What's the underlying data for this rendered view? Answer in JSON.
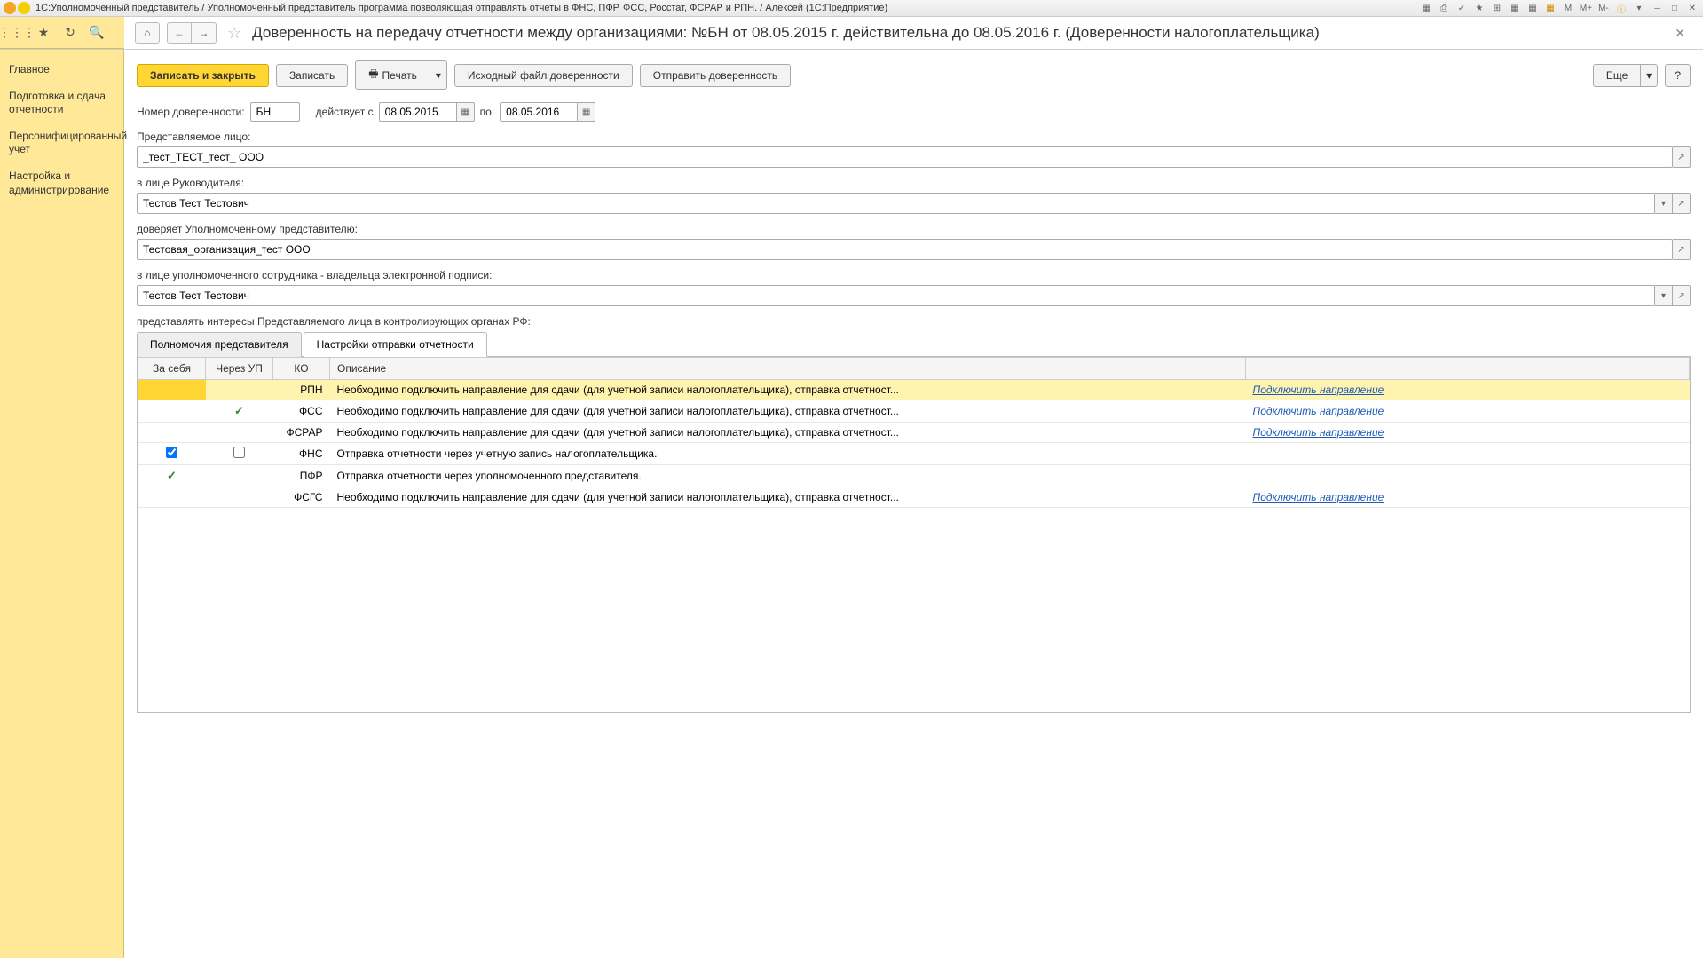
{
  "titlebar": {
    "text": "1С:Уполномоченный представитель / Уполномоченный представитель программа позволяющая отправлять отчеты в ФНС, ПФР, ФСС, Росстат, ФСРАР и РПН. / Алексей  (1С:Предприятие)",
    "winIcons": [
      "M",
      "M+",
      "M-"
    ]
  },
  "page": {
    "title": "Доверенность на передачу отчетности между организациями: №БН от 08.05.2015 г. действительна до 08.05.2016 г. (Доверенности налогоплательщика)"
  },
  "sidebar": {
    "items": [
      {
        "label": "Главное"
      },
      {
        "label": "Подготовка и сдача отчетности"
      },
      {
        "label": "Персонифицированный учет"
      },
      {
        "label": "Настройка и администрирование"
      }
    ]
  },
  "actions": {
    "saveClose": "Записать и закрыть",
    "save": "Записать",
    "print": "Печать",
    "sourceFile": "Исходный файл доверенности",
    "send": "Отправить доверенность",
    "more": "Еще",
    "help": "?"
  },
  "form": {
    "numLabel": "Номер доверенности:",
    "numValue": "БН",
    "fromLabel": "действует с",
    "fromDate": "08.05.2015",
    "toLabel": "по:",
    "toDate": "08.05.2016",
    "orgLabel": "Представляемое лицо:",
    "orgValue": "_тест_ТЕСТ_тест_ ООО",
    "headLabel": "в лице Руководителя:",
    "headValue": "Тестов Тест Тестович",
    "repLabel": "доверяет Уполномоченному представителю:",
    "repValue": "Тестовая_организация_тест ООО",
    "empLabel": "в лице уполномоченного сотрудника  - владельца электронной подписи:",
    "empValue": "Тестов Тест Тестович",
    "interestsLabel": "представлять интересы Представляемого лица в контролирующих органах РФ:"
  },
  "tabs": {
    "t1": "Полномочия представителя",
    "t2": "Настройки отправки отчетности"
  },
  "table": {
    "headers": {
      "self": "За себя",
      "up": "Через УП",
      "ko": "КО",
      "desc": "Описание"
    },
    "linkText": "Подключить направление",
    "rows": [
      {
        "self": "",
        "up": "",
        "ko": "РПН",
        "desc": "Необходимо подключить направление для сдачи (для учетной записи налогоплательщика), отправка отчетност...",
        "link": true,
        "selected": true
      },
      {
        "self": "",
        "up": "check",
        "ko": "ФСС",
        "desc": "Необходимо подключить направление для сдачи (для учетной записи налогоплательщика), отправка отчетност...",
        "link": true
      },
      {
        "self": "",
        "up": "",
        "ko": "ФСРАР",
        "desc": "Необходимо подключить направление для сдачи (для учетной записи налогоплательщика), отправка отчетност...",
        "link": true
      },
      {
        "self": "checkbox-on",
        "up": "checkbox-off",
        "ko": "ФНС",
        "desc": "Отправка отчетности через учетную запись налогоплательщика.",
        "link": false
      },
      {
        "self": "check",
        "up": "",
        "ko": "ПФР",
        "desc": "Отправка отчетности через уполномоченного представителя.",
        "link": false
      },
      {
        "self": "",
        "up": "",
        "ko": "ФСГС",
        "desc": "Необходимо подключить направление для сдачи (для учетной записи налогоплательщика), отправка отчетност...",
        "link": true
      }
    ]
  }
}
